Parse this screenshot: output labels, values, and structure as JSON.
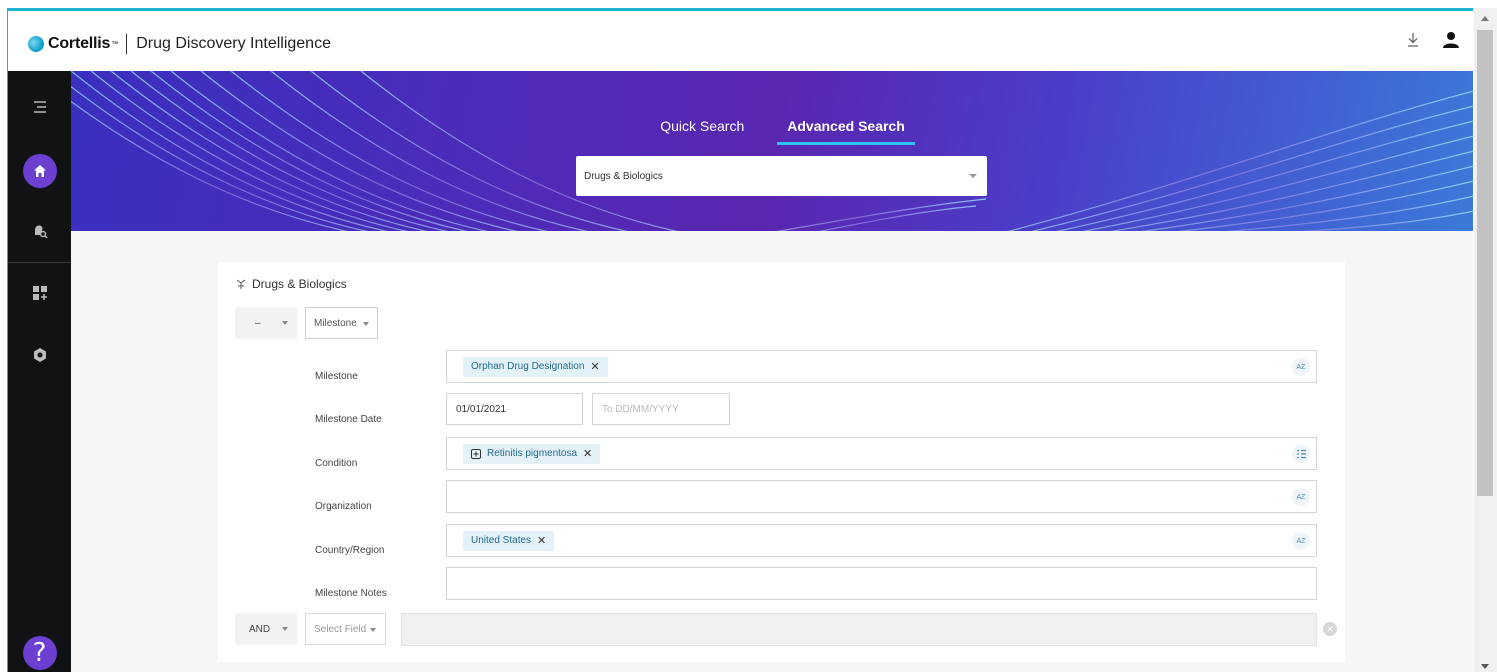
{
  "header": {
    "brand": "Cortellis",
    "brand_tm": "™",
    "product": "Drug Discovery Intelligence"
  },
  "sidebar": {
    "items": [
      {
        "icon": "menu-icon"
      },
      {
        "icon": "home-icon",
        "active": true
      },
      {
        "icon": "alert-search-icon"
      },
      {
        "icon": "dashboard-add-icon"
      },
      {
        "icon": "hexagon-icon"
      }
    ],
    "help_label": "?"
  },
  "banner": {
    "tabs": [
      {
        "label": "Quick Search",
        "active": false
      },
      {
        "label": "Advanced Search",
        "active": true
      }
    ],
    "database_select": "Drugs & Biologics"
  },
  "form": {
    "title": "Drugs & Biologics",
    "group_operator": "–",
    "group_field": "Milestone",
    "rows": {
      "milestone": {
        "label": "Milestone",
        "chips": [
          "Orphan Drug Designation"
        ],
        "end_icon": "AZ"
      },
      "milestone_date": {
        "label": "Milestone Date",
        "from": "01/01/2021",
        "to_placeholder": "To DD/MM/YYYY"
      },
      "condition": {
        "label": "Condition",
        "chips": [
          "Retinitis pigmentosa"
        ]
      },
      "organization": {
        "label": "Organization",
        "end_icon": "AZ"
      },
      "country": {
        "label": "Country/Region",
        "chips": [
          "United States"
        ],
        "end_icon": "AZ"
      },
      "notes": {
        "label": "Milestone Notes"
      }
    },
    "next_operator": "AND",
    "next_field_placeholder": "Select Field"
  },
  "colors": {
    "accent": "#6b3fd0",
    "tab_underline": "#2ec4f1",
    "chip_bg": "#e3f1f8",
    "top_border": "#1db2d6"
  }
}
